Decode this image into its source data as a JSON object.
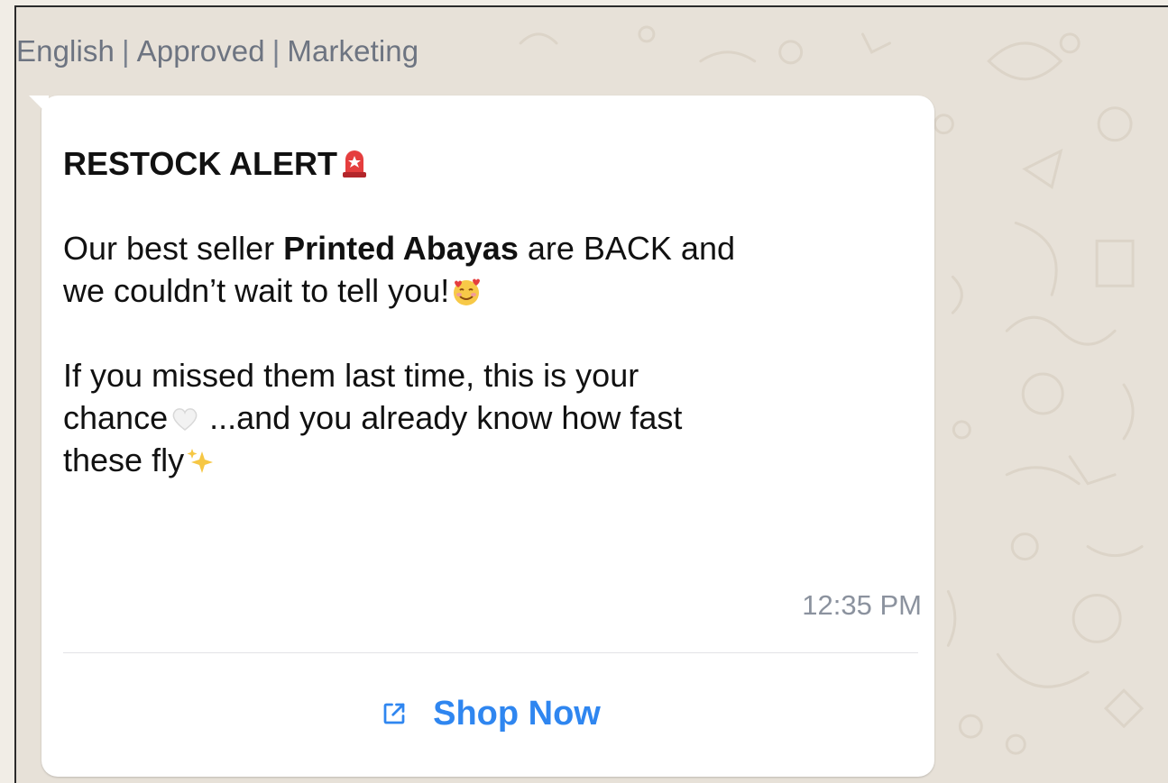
{
  "template": {
    "language": "English",
    "status": "Approved",
    "category": "Marketing"
  },
  "message": {
    "headline": "RESTOCK ALERT",
    "headline_emoji": "rotating-light-icon",
    "line1_pre": "Our best seller ",
    "line1_bold": "Printed Abayas",
    "line1_post": " are BACK and",
    "line2": "we couldn’t wait to tell you!",
    "line2_emoji": "smiling-face-with-hearts-icon",
    "line3": "If you missed them last time, this is your",
    "line4_pre": "chance",
    "line4_emoji": "white-heart-icon",
    "line4_post": " ...and you already know how fast",
    "line5": "these fly",
    "line5_emoji": "sparkles-icon",
    "timestamp": "12:35 PM"
  },
  "buttons": {
    "cta_label": "Shop Now",
    "cta_icon": "external-link-icon"
  },
  "colors": {
    "accent": "#2f86f0",
    "bubble": "#ffffff",
    "wallpaper": "#e7e1d8",
    "meta_text": "#6d7481"
  }
}
